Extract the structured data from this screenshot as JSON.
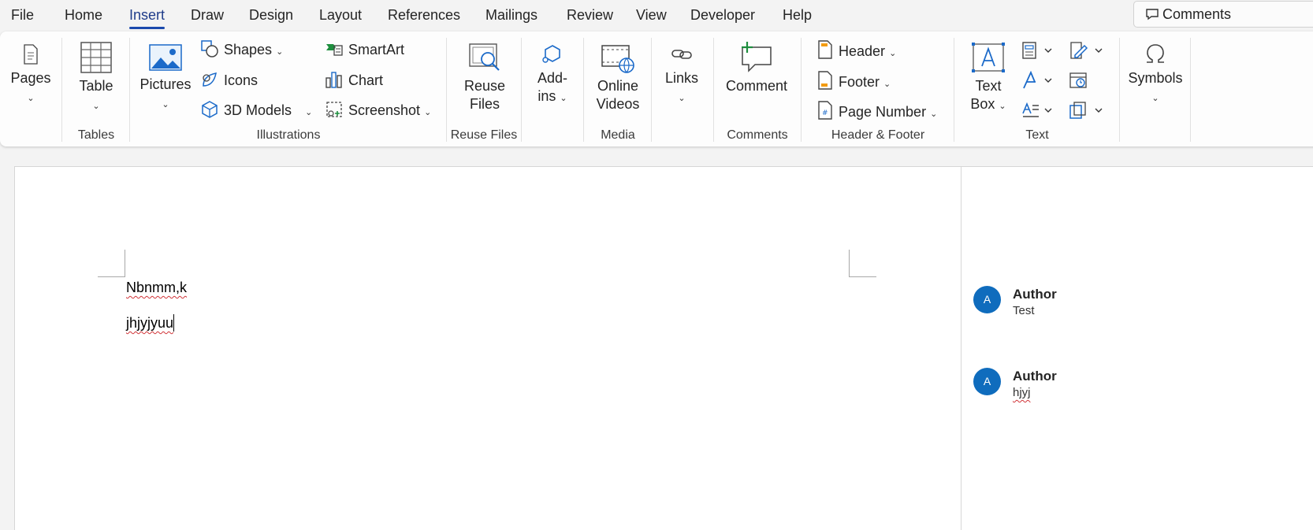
{
  "menu": {
    "items": [
      "File",
      "Home",
      "Insert",
      "Draw",
      "Design",
      "Layout",
      "References",
      "Mailings",
      "Review",
      "View",
      "Developer",
      "Help"
    ],
    "active": "Insert",
    "comments_button": "Comments"
  },
  "ribbon": {
    "pages": {
      "label": "Pages"
    },
    "tables": {
      "table": "Table",
      "group": "Tables"
    },
    "illustrations": {
      "pictures": "Pictures",
      "shapes": "Shapes",
      "icons": "Icons",
      "models3d": "3D Models",
      "smartart": "SmartArt",
      "chart": "Chart",
      "screenshot": "Screenshot",
      "group": "Illustrations"
    },
    "reuse": {
      "line1": "Reuse",
      "line2": "Files",
      "group": "Reuse Files"
    },
    "addins": {
      "line1": "Add-",
      "line2": "ins"
    },
    "media": {
      "line1": "Online",
      "line2": "Videos",
      "group": "Media"
    },
    "links": {
      "label": "Links"
    },
    "comments": {
      "comment": "Comment",
      "group": "Comments"
    },
    "header_footer": {
      "header": "Header",
      "footer": "Footer",
      "page_number": "Page Number",
      "group": "Header & Footer"
    },
    "text": {
      "textbox_line1": "Text",
      "textbox_line2": "Box",
      "group": "Text"
    },
    "symbols": {
      "label": "Symbols"
    }
  },
  "document": {
    "lines": [
      "Nbnmm,k",
      "jhjyjyuu"
    ]
  },
  "comments": [
    {
      "avatar": "A",
      "author": "Author",
      "text": "Test"
    },
    {
      "avatar": "A",
      "author": "Author",
      "text": "hjyj"
    }
  ],
  "colors": {
    "accent": "#1a49ad",
    "avatar": "#0f6cbd",
    "spellcheck": "#d13438",
    "icon_blue": "#1b6ac9",
    "icon_green": "#1e8e3e"
  }
}
